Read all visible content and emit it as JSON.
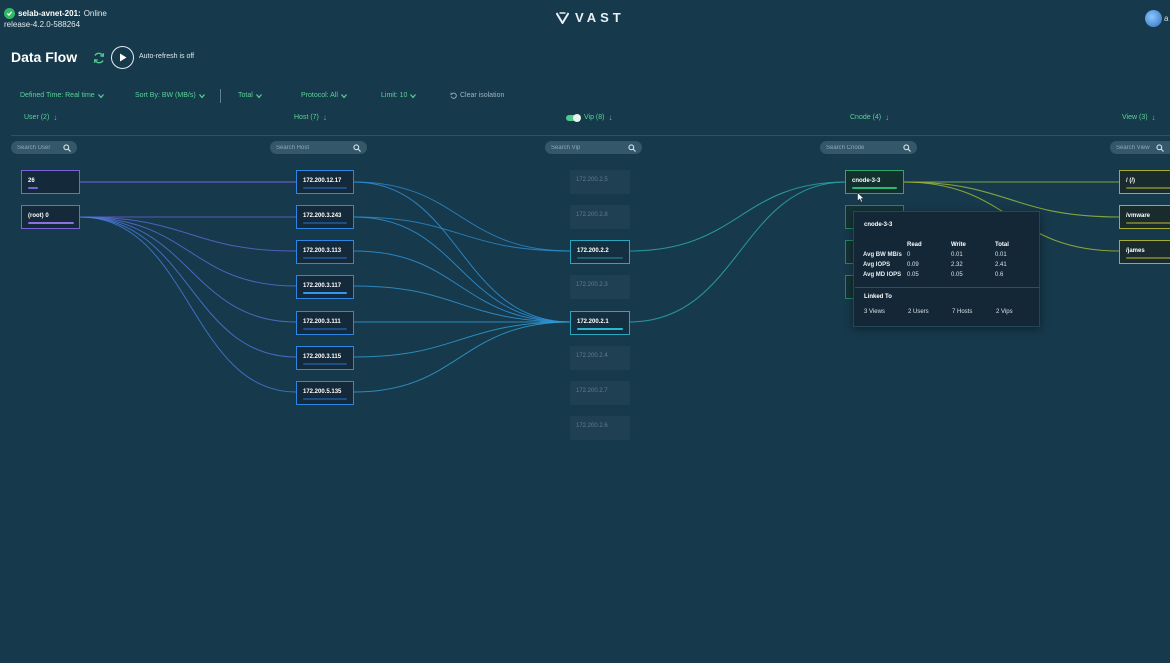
{
  "header": {
    "cluster_name": "selab-avnet-201:",
    "cluster_status": "Online",
    "release": "release-4.2.0-588264",
    "logo_text": "VAST",
    "user_initial": "a"
  },
  "page": {
    "title": "Data Flow",
    "auto_refresh_label": "Auto-refresh is off"
  },
  "filters": {
    "defined_time": "Defined Time: Real time",
    "sort_by": "Sort By:  BW (MB/s)",
    "total": "Total",
    "protocol": "Protocol:  All",
    "limit": "Limit:  10",
    "clear_isolation": "Clear isolation"
  },
  "columns": {
    "user": {
      "title": "User (2)",
      "search_placeholder": "Search User"
    },
    "host": {
      "title": "Host (7)",
      "search_placeholder": "Search Host"
    },
    "vip": {
      "title": "Vip (8)",
      "search_placeholder": "Search Vip"
    },
    "cnode": {
      "title": "Cnode (4)",
      "search_placeholder": "Search Cnode"
    },
    "view": {
      "title": "View (3)",
      "search_placeholder": "Search View"
    }
  },
  "users": [
    "26",
    "(root) 0"
  ],
  "hosts": [
    "172.200.12.17",
    "172.200.3.243",
    "172.200.3.113",
    "172.200.3.117",
    "172.200.3.111",
    "172.200.3.115",
    "172.200.5.135"
  ],
  "vips": [
    "172.200.2.5",
    "172.200.2.8",
    "172.200.2.2",
    "172.200.2.3",
    "172.200.2.1",
    "172.200.2.4",
    "172.200.2.7",
    "172.200.2.6"
  ],
  "vip_active": [
    false,
    false,
    true,
    false,
    true,
    false,
    false,
    false
  ],
  "cnodes": [
    "cnode-3-3"
  ],
  "views": [
    "/ (/)",
    "/vmware",
    "/james"
  ],
  "tooltip": {
    "title": "cnode-3-3",
    "headers": [
      "Read",
      "Write",
      "Total"
    ],
    "rows": [
      {
        "label": "Avg BW MB/s",
        "read": "0",
        "write": "0.01",
        "total": "0.01"
      },
      {
        "label": "Avg IOPS",
        "read": "0.09",
        "write": "2.32",
        "total": "2.41"
      },
      {
        "label": "Avg MD IOPS",
        "read": "0.05",
        "write": "0.05",
        "total": "0.6"
      }
    ],
    "linked_title": "Linked To",
    "linked": [
      "3  Views",
      "2  Users",
      "7  Hosts",
      "2  Vips"
    ]
  },
  "colors": {
    "background": "#16394b",
    "accent": "#5bd39a",
    "user_link": "#7b62d8",
    "host_link": "#2b86e4",
    "vip_link": "#2aa6bf",
    "view_link": "#a6ad31"
  }
}
